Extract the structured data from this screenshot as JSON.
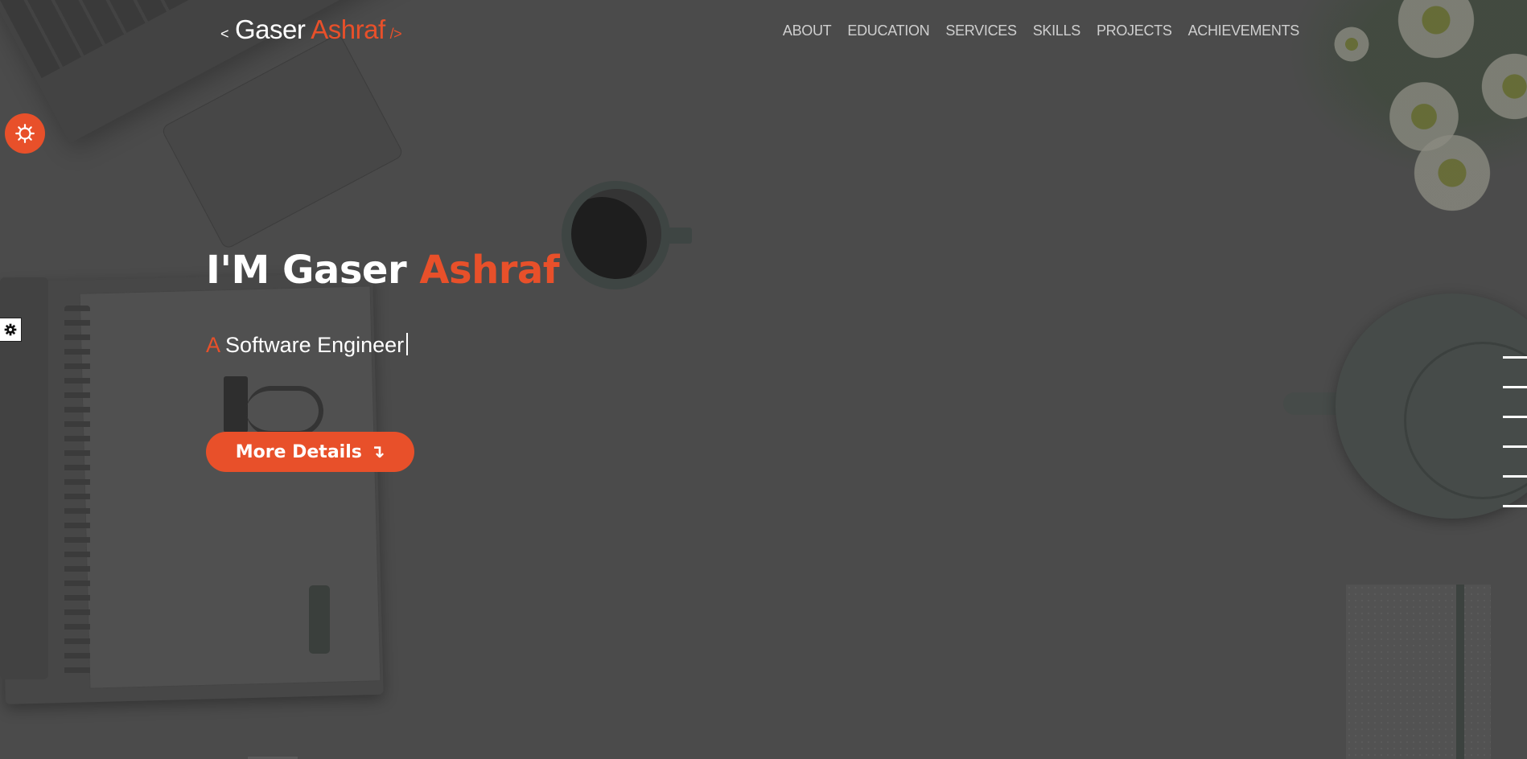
{
  "brand": {
    "open_tag": "<",
    "first_name": "Gaser",
    "last_name": "Ashraf",
    "close_tag": "/>"
  },
  "nav": {
    "items": [
      {
        "label": "ABOUT"
      },
      {
        "label": "EDUCATION"
      },
      {
        "label": "SERVICES"
      },
      {
        "label": "SKILLS"
      },
      {
        "label": "PROJECTS"
      },
      {
        "label": "ACHIEVEMENTS"
      }
    ]
  },
  "hero": {
    "title_prefix": "I'M Gaser",
    "title_accent": "Ashraf",
    "subtitle_accent": "A",
    "subtitle_text": "Software Engineer",
    "cta_label": "More Details",
    "cta_icon": "↴"
  },
  "icons": {
    "settings_fab": "gear-icon",
    "settings_tab": "cog-icon",
    "cta_arrow": "arrow-down-icon"
  },
  "colors": {
    "accent": "#e8502a",
    "overlay": "#4b4b4b",
    "text": "#ffffff",
    "nav_text": "#cfcfcf"
  },
  "side_nav": {
    "count": 6
  }
}
